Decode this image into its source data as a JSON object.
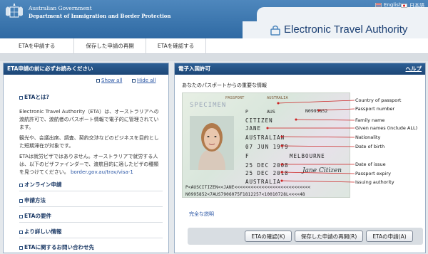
{
  "header": {
    "gov_line1": "Australian Government",
    "gov_line2": "Department of Immigration and Border Protection",
    "app_title": "Electronic Travel Authority",
    "lang_en": "English",
    "lang_ja": "日本語"
  },
  "nav": {
    "items": [
      {
        "label": "ETAを申請する"
      },
      {
        "label": "保存した申請の再開"
      },
      {
        "label": "ETAを確認する"
      }
    ]
  },
  "left_panel": {
    "title": "ETA申請の前に必ずお読みください",
    "show_all": "Show all",
    "hide_all": "Hide all",
    "section_what": "ETAとは?",
    "para1": "Electronic Travel Authority（ETA）は、オーストラリアへの渡航許可で、渡航者のパスポート情報で電子的に管理されています。",
    "para2": "観光や、会議出席、調査、契約交渉などのビジネスを目的とした短期滞在が対象です。",
    "para3": "ETAは就労ビザではありません。オーストラリアで就労する人は、以下のビザファインダーで、渡航目的に適したビザの種類を見つけてください。",
    "para3_link": "border.gov.au/trav/visa-1",
    "sections": [
      {
        "label": "オンライン申請"
      },
      {
        "label": "申請方法"
      },
      {
        "label": "ETAの要件"
      },
      {
        "label": "より詳しい情報"
      },
      {
        "label": "ETAに関するお問い合わせ先"
      }
    ]
  },
  "right_panel": {
    "title": "電子入国許可",
    "help": "ヘルプ",
    "subtitle": "あなたのパスポートからの重要な情報",
    "passport": {
      "passport_word": "PASSPORT",
      "specimen": "SPECIMEN",
      "country_word": "AUSTRALIA",
      "type": "P",
      "code": "AUS",
      "number": "N0995852",
      "surname": "CITIZEN",
      "given": "JANE",
      "nationality": "AUSTRALIAN",
      "dob": "07 JUN 1979",
      "sex": "F",
      "place": "MELBOURNE",
      "issue": "25 DEC 2008",
      "expiry": "25 DEC 2018",
      "authority": "AUSTRALIA",
      "signature": "Jane Citizen",
      "mrz1": "P<AUSCITIZEN<<JANE<<<<<<<<<<<<<<<<<<<<<<<<<<<<",
      "mrz2": "N0995852<7AUS7906075F1812257<10010728L<<<<48"
    },
    "callouts": [
      {
        "label": "Country of passport"
      },
      {
        "label": "Passport number"
      },
      {
        "label": "Family name"
      },
      {
        "label": "Given names (include ALL)"
      },
      {
        "label": "Nationality"
      },
      {
        "label": "Date of birth"
      },
      {
        "label": "Date of issue"
      },
      {
        "label": "Passport expiry"
      },
      {
        "label": "Issuing authority"
      }
    ],
    "full_description": "完全な説明",
    "buttons": {
      "check": "ETAの確認(K)",
      "resume": "保存した申請の再開(R)",
      "apply": "ETAの申請(A)"
    }
  },
  "colors": {
    "header_blue": "#2f6aa3",
    "panel_header": "#1c4676",
    "title_navy": "#1b3f73",
    "link_blue": "#2a56a5"
  }
}
